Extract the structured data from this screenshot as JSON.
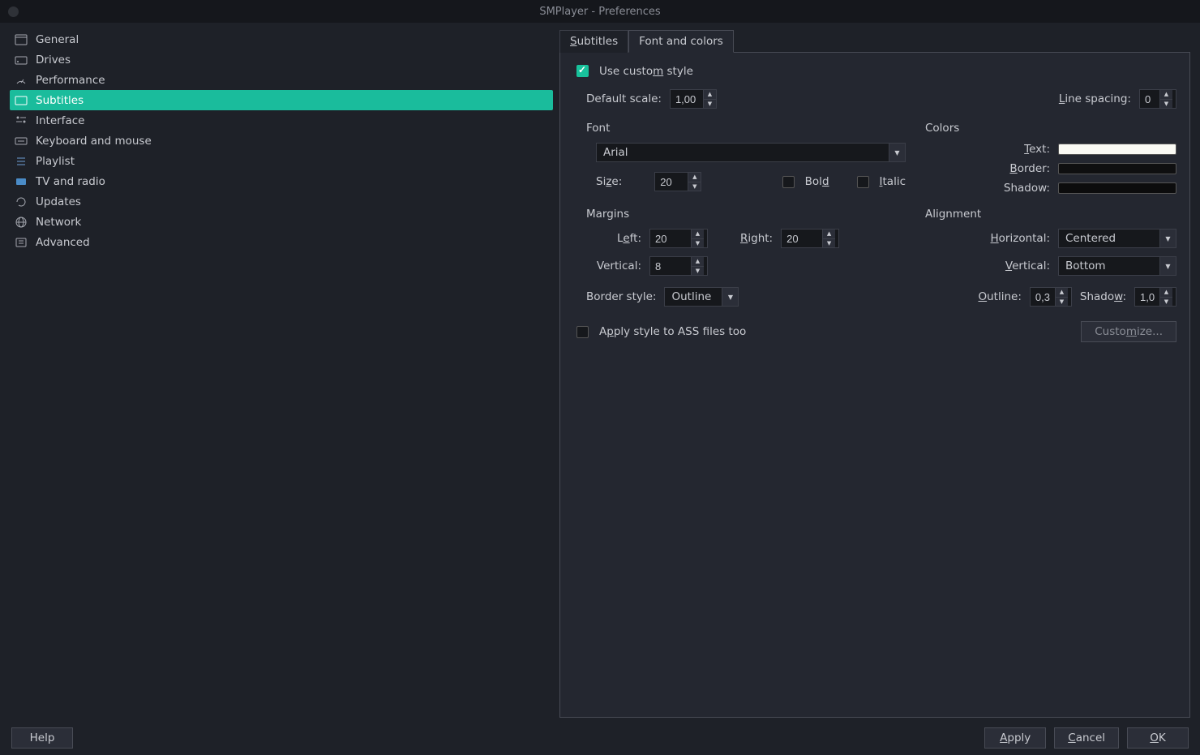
{
  "title": "SMPlayer - Preferences",
  "sidebar": {
    "items": [
      {
        "label": "General"
      },
      {
        "label": "Drives"
      },
      {
        "label": "Performance"
      },
      {
        "label": "Subtitles"
      },
      {
        "label": "Interface"
      },
      {
        "label": "Keyboard and mouse"
      },
      {
        "label": "Playlist"
      },
      {
        "label": "TV and radio"
      },
      {
        "label": "Updates"
      },
      {
        "label": "Network"
      },
      {
        "label": "Advanced"
      }
    ]
  },
  "tabs": {
    "subtitles": "Subtitles",
    "font_colors": "Font and colors"
  },
  "form": {
    "use_custom_style": "Use custom style",
    "default_scale_label": "Default scale:",
    "default_scale_value": "1,00",
    "line_spacing_label": "Line spacing:",
    "line_spacing_value": "0",
    "font_group": "Font",
    "font_name": "Arial",
    "size_label": "Size:",
    "size_value": "20",
    "bold_label": "Bold",
    "italic_label": "Italic",
    "colors_group": "Colors",
    "text_label": "Text:",
    "border_label": "Border:",
    "shadow_label": "Shadow:",
    "margins_group": "Margins",
    "left_label": "Left:",
    "left_value": "20",
    "right_label": "Right:",
    "right_value": "20",
    "vertical_margin_label": "Vertical:",
    "vertical_margin_value": "8",
    "alignment_group": "Alignment",
    "horizontal_label": "Horizontal:",
    "horizontal_value": "Centered",
    "vertical_align_label": "Vertical:",
    "vertical_align_value": "Bottom",
    "border_style_label": "Border style:",
    "border_style_value": "Outline",
    "outline_label": "Outline:",
    "outline_value": "0,30",
    "shadow_width_label": "Shadow:",
    "shadow_width_value": "1,00",
    "apply_ass": "Apply style to ASS files too",
    "customize": "Customize..."
  },
  "footer": {
    "help": "Help",
    "apply": "Apply",
    "cancel": "Cancel",
    "ok": "OK"
  },
  "colors": {
    "text": "#fafaf4",
    "border": "#0f0f10",
    "shadow": "#0c0c0d"
  }
}
